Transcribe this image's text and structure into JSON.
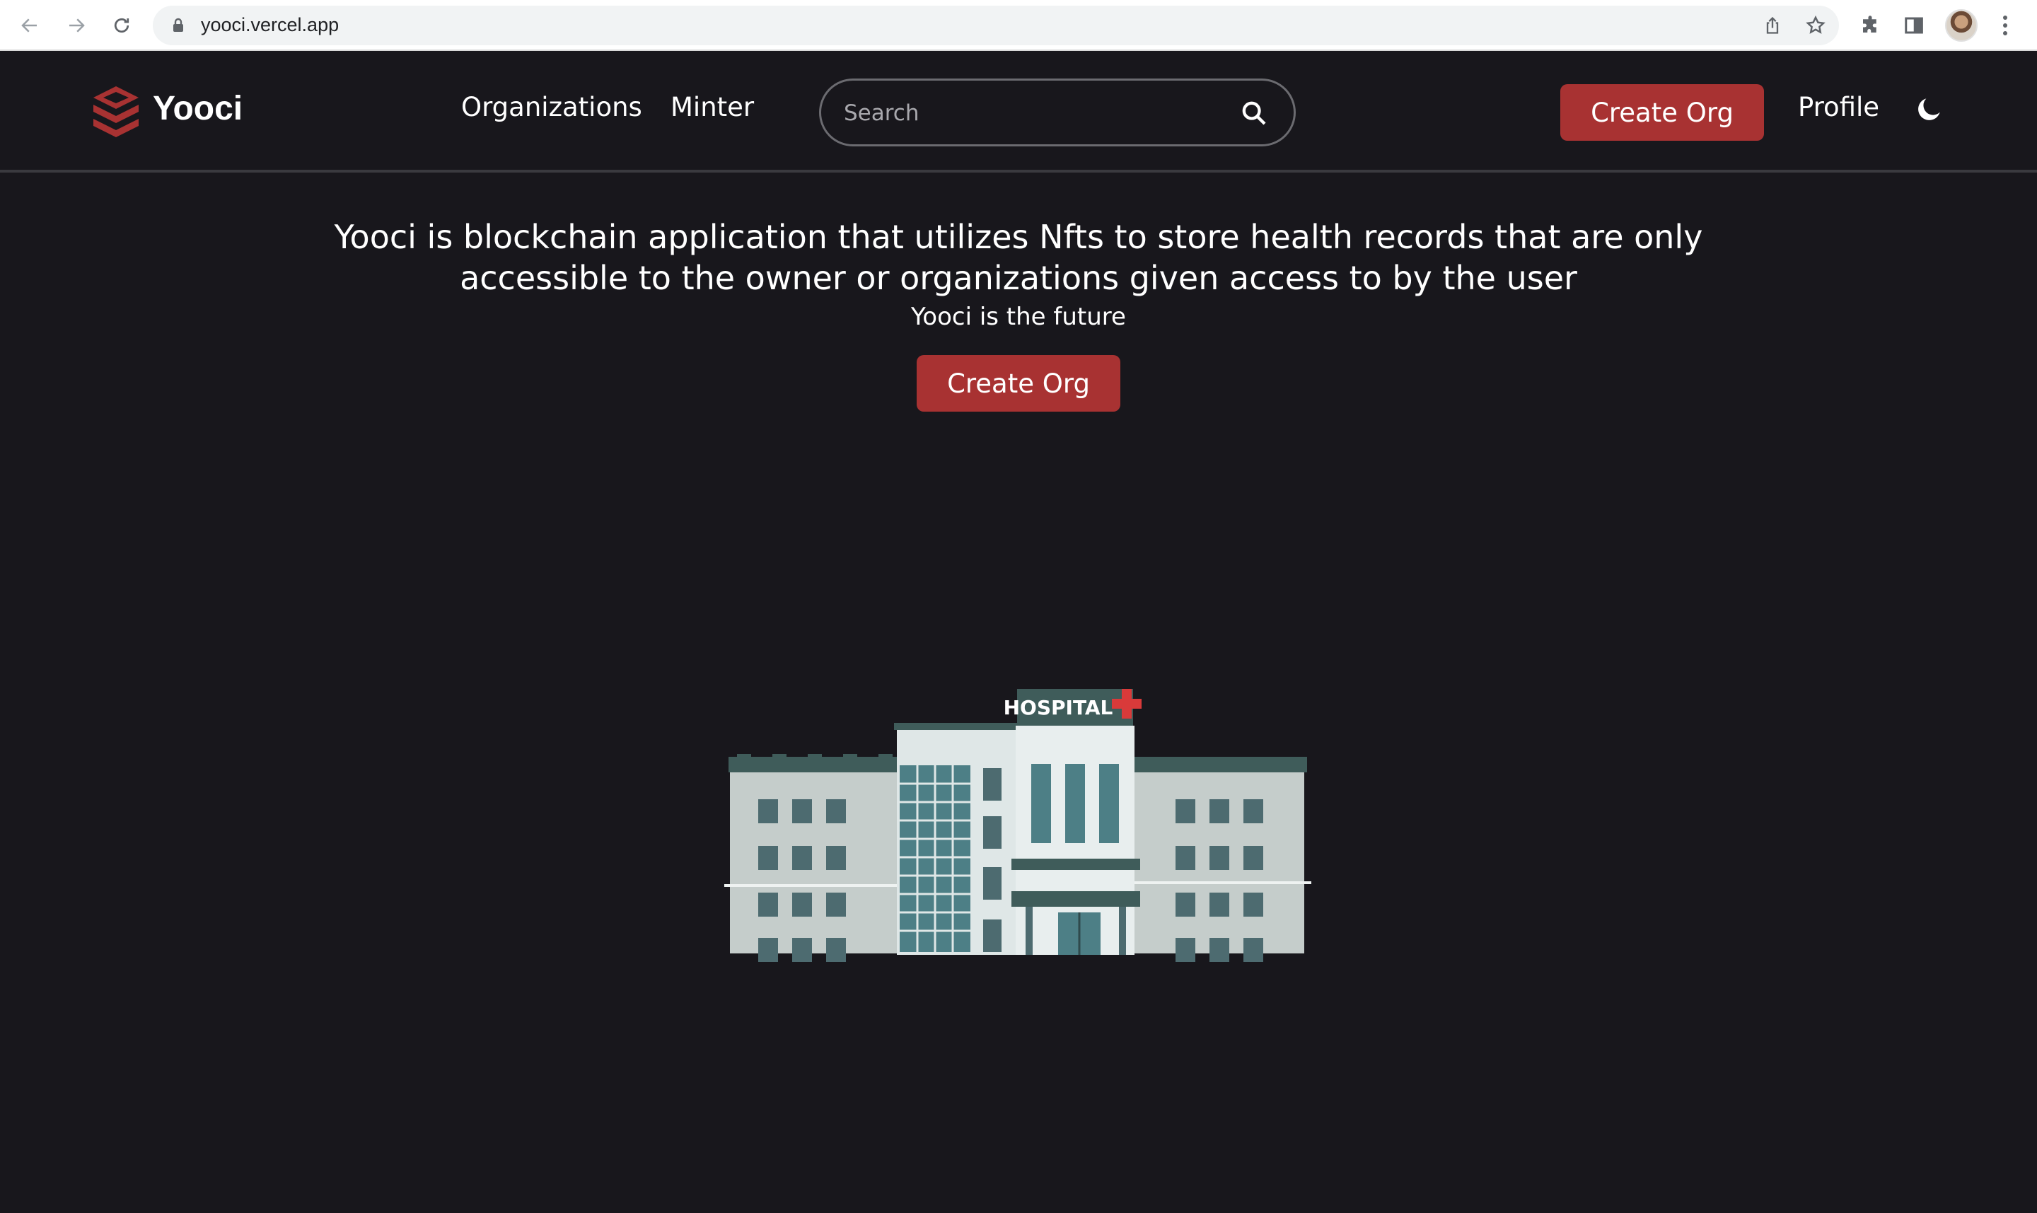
{
  "browser": {
    "url": "yooci.vercel.app"
  },
  "header": {
    "brand": "Yooci",
    "nav": {
      "organizations": "Organizations",
      "minter": "Minter"
    },
    "search": {
      "placeholder": "Search",
      "value": ""
    },
    "create_org_label": "Create Org",
    "profile_label": "Profile"
  },
  "hero": {
    "headline": "Yooci is blockchain application that utilizes Nfts to store health records that are only accessible to the owner or organizations given access to by the user",
    "subline": "Yooci is the future",
    "cta_label": "Create Org"
  },
  "illustration": {
    "sign_text": "HOSPITAL"
  },
  "colors": {
    "background": "#18171c",
    "accent": "#a83232",
    "text": "#ffffff",
    "divider": "#3a3a3f"
  },
  "icons": {
    "logo": "layered-cube-icon",
    "search": "search-icon",
    "theme_toggle": "moon-icon"
  }
}
